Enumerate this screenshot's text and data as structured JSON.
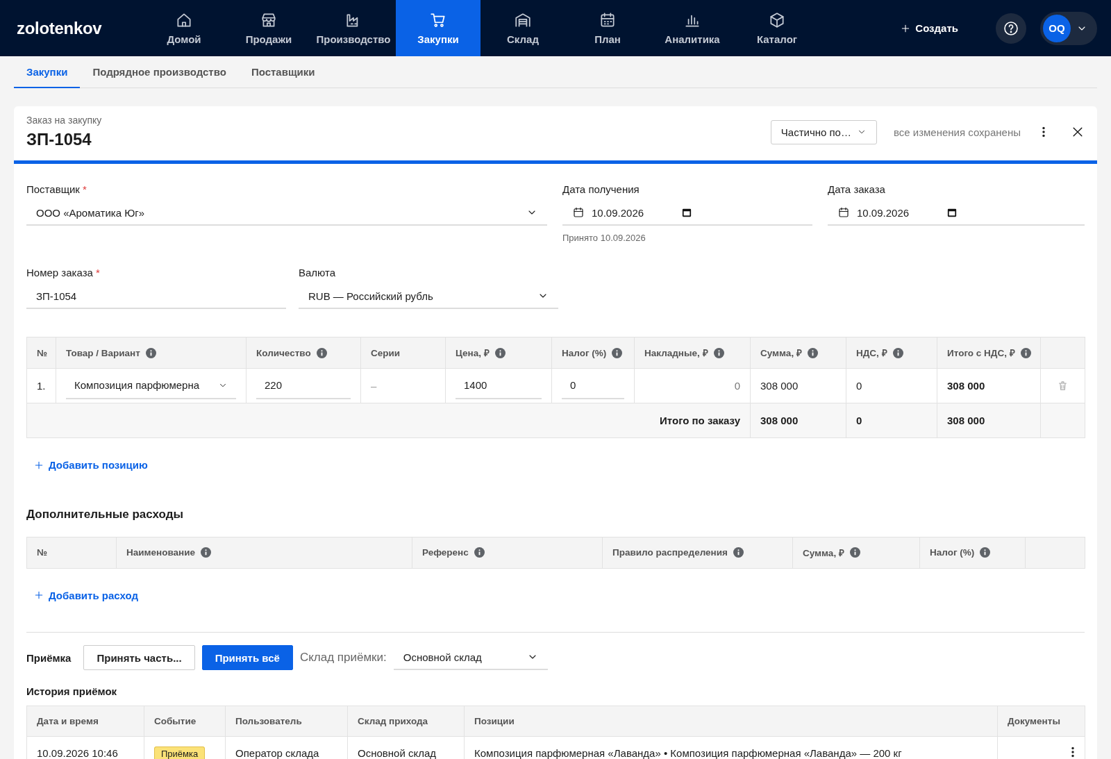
{
  "nav": {
    "logo": "zolotenkov",
    "items": [
      {
        "label": "Домой",
        "selected": false
      },
      {
        "label": "Продажи",
        "selected": false
      },
      {
        "label": "Производство",
        "selected": false
      },
      {
        "label": "Закупки",
        "selected": true
      },
      {
        "label": "Склад",
        "selected": false
      },
      {
        "label": "План",
        "selected": false
      },
      {
        "label": "Аналитика",
        "selected": false
      },
      {
        "label": "Каталог",
        "selected": false
      }
    ],
    "create": "Создать",
    "avatar": "OQ"
  },
  "subtabs": [
    {
      "label": "Закупки",
      "selected": true
    },
    {
      "label": "Подрядное производство",
      "selected": false
    },
    {
      "label": "Поставщики",
      "selected": false
    }
  ],
  "order": {
    "subtitle": "Заказ на закупку",
    "title": "ЗП-1054",
    "status": "Частично по…",
    "saved": "все изменения сохранены"
  },
  "fields": [
    [
      {
        "label": "Поставщик",
        "required_mark": "*",
        "kind": "select",
        "value": "ООО «Ароматика Юг»"
      },
      {
        "label": "Дата получения",
        "kind": "date",
        "value": "10.09.2026",
        "hint": "Принято 10.09.2026"
      },
      {
        "label": "Дата заказа",
        "kind": "date",
        "value": "10.09.2026"
      }
    ],
    [
      {
        "label": "Номер заказа",
        "required_mark": "*",
        "kind": "text",
        "value": "ЗП-1054"
      },
      {
        "label": "Валюта",
        "kind": "select",
        "value": "RUB — Российский рубль"
      }
    ]
  ],
  "items": {
    "columns": [
      {
        "label": "№",
        "info": false
      },
      {
        "label": "Товар / Вариант",
        "info": true
      },
      {
        "label": "Количество",
        "info": true
      },
      {
        "label": "Серии",
        "info": false
      },
      {
        "label": "Цена, ₽",
        "info": true
      },
      {
        "label": "Налог (%)",
        "info": true
      },
      {
        "label": "Накладные, ₽",
        "info": true
      },
      {
        "label": "Сумма, ₽",
        "info": true
      },
      {
        "label": "НДС, ₽",
        "info": true
      },
      {
        "label": "Итого с НДС, ₽",
        "info": true
      }
    ],
    "rows": [
      {
        "cells": [
          {
            "kind": "text",
            "value": "1."
          },
          {
            "kind": "select",
            "value": "Композиция парфюмерна"
          },
          {
            "kind": "input",
            "value": "220"
          },
          {
            "kind": "muted",
            "value": "–"
          },
          {
            "kind": "input",
            "value": "1400"
          },
          {
            "kind": "input",
            "value": "0"
          },
          {
            "kind": "number",
            "value": "0"
          },
          {
            "kind": "text",
            "value": "308 000"
          },
          {
            "kind": "text",
            "value": "0"
          },
          {
            "kind": "bold",
            "value": "308 000"
          }
        ]
      }
    ],
    "totals": {
      "label": "Итого по заказу",
      "values": [
        "308 000",
        "0",
        "308 000"
      ]
    }
  },
  "add_item": "Добавить позицию",
  "extra": {
    "title": "Дополнительные расходы",
    "columns": [
      {
        "label": "№",
        "info": false
      },
      {
        "label": "Наименование",
        "info": true
      },
      {
        "label": "Референс",
        "info": true
      },
      {
        "label": "Правило распределения",
        "info": true
      },
      {
        "label": "Сумма, ₽",
        "info": true
      },
      {
        "label": "Налог (%)",
        "info": true
      }
    ],
    "add": "Добавить расход"
  },
  "receiving": {
    "label": "Приёмка",
    "buttons": [
      {
        "label": "Принять часть...",
        "primary": false
      },
      {
        "label": "Принять всё",
        "primary": true
      }
    ],
    "warehouse_label": "Склад приёмки:",
    "warehouse": "Основной склад"
  },
  "history": {
    "title": "История приёмок",
    "columns": [
      "Дата и время",
      "Событие",
      "Пользователь",
      "Склад прихода",
      "Позиции",
      "Документы"
    ],
    "rows": [
      {
        "date": "10.09.2026 10:46",
        "event": "Приёмка",
        "user": "Оператор склада",
        "warehouse": "Основной склад",
        "positions": "Композиция парфюмерная «Лаванда» • Композиция парфюмерная «Лаванда» — 200 кг"
      }
    ]
  }
}
